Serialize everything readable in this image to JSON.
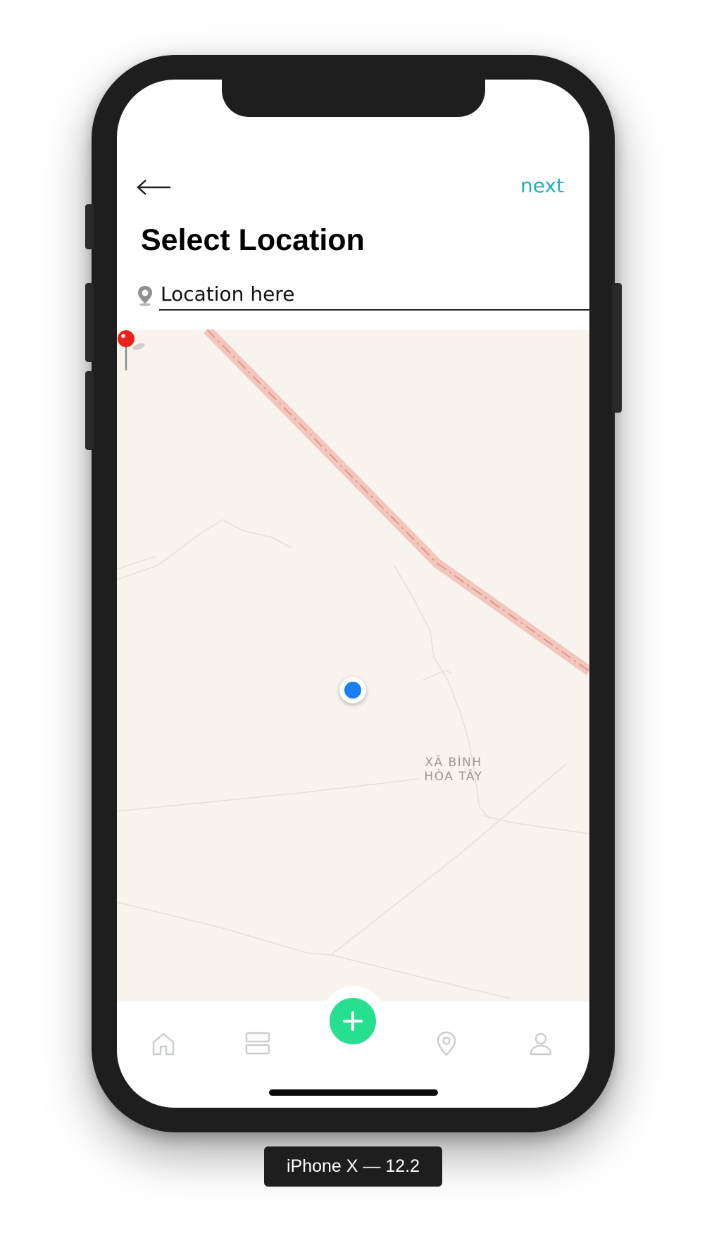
{
  "header": {
    "back_icon": "arrow-left-icon",
    "next_label": "next",
    "title": "Select Location"
  },
  "search": {
    "icon": "map-pin-icon",
    "value": "Location here"
  },
  "map": {
    "area_label_line1": "XÃ BÌNH",
    "area_label_line2": "HÒA TÂY",
    "colors": {
      "background": "#f8f4ed",
      "highway": "#f3c6bd",
      "minor_road": "#e4e0da",
      "pin": "#e8231d",
      "user_location": "#1a7ef5"
    }
  },
  "tabbar": {
    "items": [
      {
        "icon": "home-icon"
      },
      {
        "icon": "feed-icon"
      },
      {
        "icon": "add-icon"
      },
      {
        "icon": "location-pin-icon"
      },
      {
        "icon": "profile-icon"
      }
    ],
    "accent": "#27e08f"
  },
  "device": {
    "caption": "iPhone X — 12.2"
  },
  "colors": {
    "accent": "#1fb2b7",
    "frame": "#1e1e1e"
  }
}
